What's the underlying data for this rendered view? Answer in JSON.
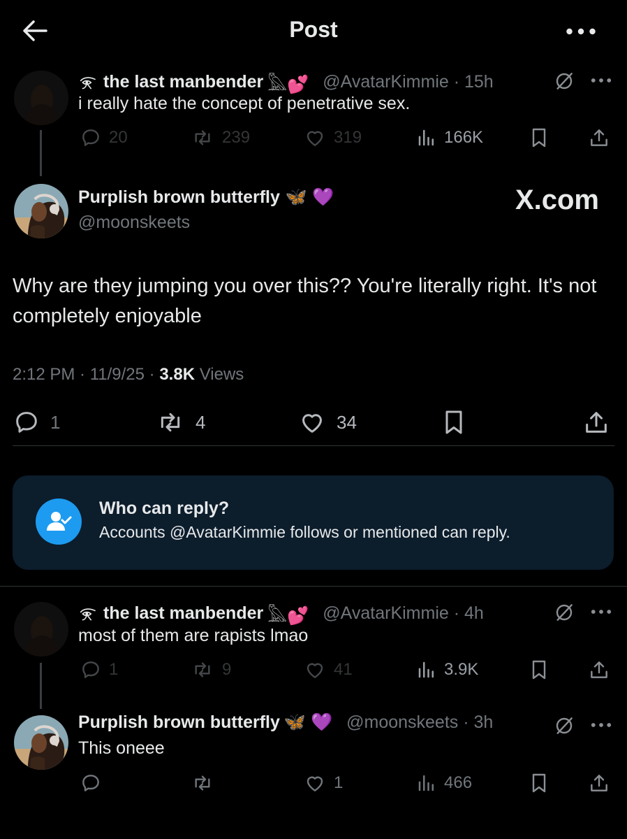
{
  "header": {
    "title": "Post",
    "back_icon": "arrow-left-icon",
    "more_icon": "more-horizontal-icon"
  },
  "watermark": "X.com",
  "tweets": [
    {
      "name": "the last manbender",
      "name_prefix_icon": "eye-of-horus-icon",
      "name_suffix": "𓅓💕",
      "handle_time": "@AvatarKimmie · 15h",
      "text": "i really hate the concept of penetrative sex.",
      "replies": "20",
      "reposts": "239",
      "likes": "319",
      "views": "166K"
    },
    {
      "name": "the last manbender",
      "name_prefix_icon": "eye-of-horus-icon",
      "name_suffix": "𓅓💕",
      "handle_time": "@AvatarKimmie · 4h",
      "text": "most of them are rapists lmao",
      "replies": "1",
      "reposts": "9",
      "likes": "41",
      "views": "3.9K"
    },
    {
      "name": "Purplish brown butterfly",
      "name_suffix": "🦋 💜",
      "handle_time": "@moonskeets · 3h",
      "text": "This oneee",
      "replies": "",
      "reposts": "",
      "likes": "1",
      "views": "466"
    }
  ],
  "main_post": {
    "name": "Purplish brown butterfly",
    "name_suffix": "🦋 💜",
    "handle": "@moonskeets",
    "text": "Why are they jumping you over this?? You're literally right. It's not completely enjoyable",
    "time_date": "2:12 PM · 11/9/25 · ",
    "views_count": "3.8K",
    "views_label": " Views",
    "replies": "1",
    "reposts": "4",
    "likes": "34"
  },
  "who_can_reply": {
    "title": "Who can reply?",
    "body": "Accounts @AvatarKimmie follows or mentioned can reply.",
    "icon": "person-check-icon"
  },
  "colors": {
    "background": "#000000",
    "text": "#e7e9ea",
    "muted": "#71767b",
    "accent": "#1d9bf0",
    "card": "#0c1d2c"
  }
}
